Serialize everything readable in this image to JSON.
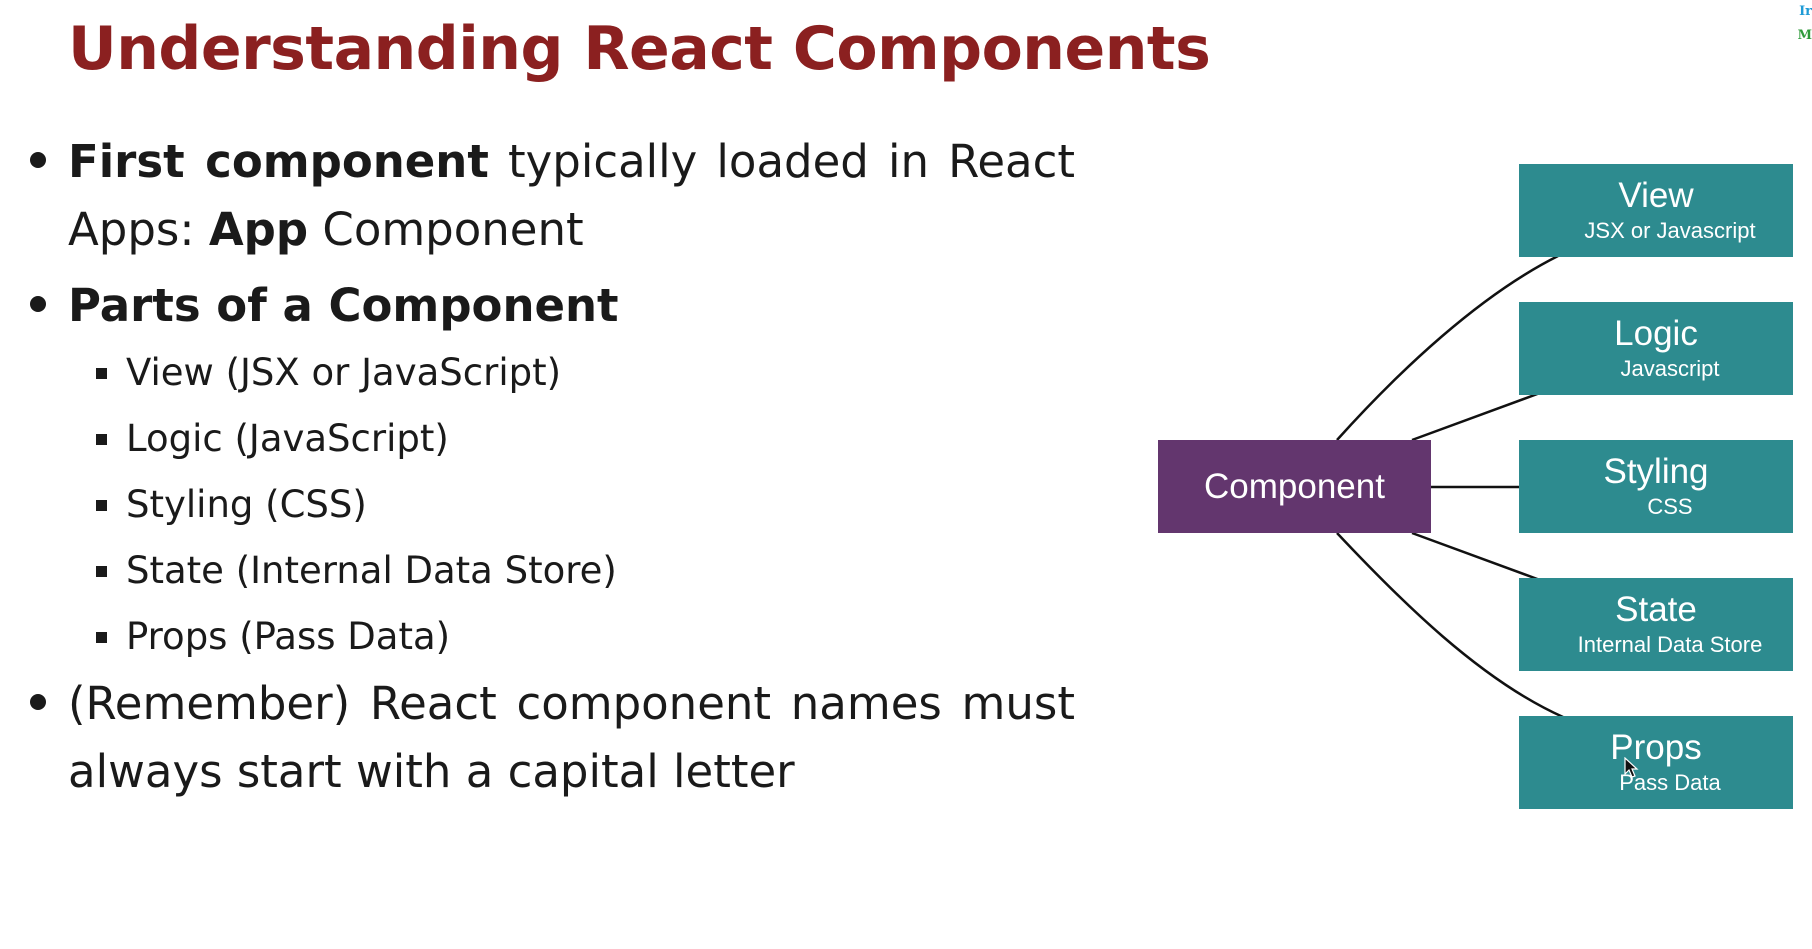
{
  "slide": {
    "title": "Understanding React Components",
    "corner_tags": [
      "Ir",
      "M"
    ]
  },
  "bullets": {
    "first_component": {
      "bold": "First component",
      "text": " typically loaded in React Apps: ",
      "bold2": "App",
      "text2": " Component"
    },
    "parts_heading": "Parts of a Component",
    "parts": [
      "View (JSX or JavaScript)",
      "Logic (JavaScript)",
      "Styling (CSS)",
      "State (Internal Data Store)",
      "Props (Pass Data)"
    ],
    "remember": "(Remember) React component names must always start with a capital letter"
  },
  "diagram": {
    "center_label": "Component",
    "center_color": "#63366e",
    "part_color": "#2d8b8f",
    "boxes": [
      {
        "title": "View",
        "subtitle": "JSX or Javascript"
      },
      {
        "title": "Logic",
        "subtitle": "Javascript"
      },
      {
        "title": "Styling",
        "subtitle": "CSS"
      },
      {
        "title": "State",
        "subtitle": "Internal Data Store"
      },
      {
        "title": "Props",
        "subtitle": "Pass Data"
      }
    ]
  }
}
